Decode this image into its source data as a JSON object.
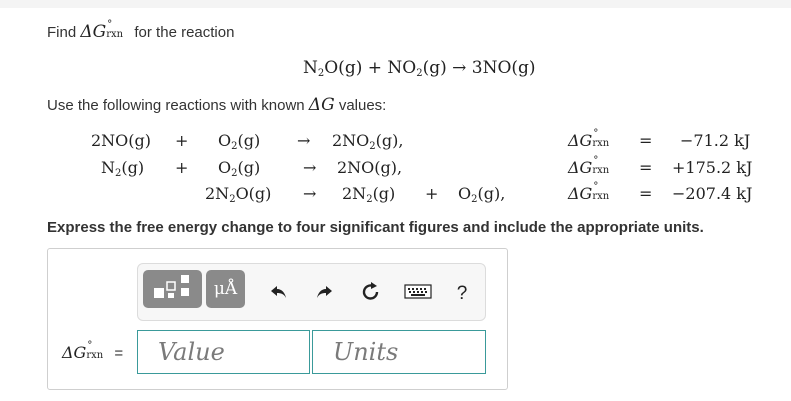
{
  "prompt": {
    "find_prefix": "Find ",
    "delta_g": "ΔG",
    "degree": "°",
    "rxn": "rxn",
    "find_suffix": " for the reaction"
  },
  "target_reaction": {
    "lhs1": "N",
    "lhs1_sub": "2",
    "lhs1_rest": "O(g) + NO",
    "lhs2_sub": "2",
    "lhs2_rest": "(g) → 3NO(g)"
  },
  "use_text": {
    "prefix": "Use the following reactions with known ",
    "delta_g": "ΔG",
    "suffix": " values:"
  },
  "reactions": [
    {
      "r1": "2NO(g)",
      "plus1": "+",
      "r2": "O",
      "r2_sub": "2",
      "r2_rest": "(g)",
      "arrow": "→",
      "p1": "2NO",
      "p1_sub": "2",
      "p1_rest": "(g),",
      "plus2": "",
      "p2": "",
      "dg": "ΔG",
      "eq": "=",
      "value": "−71.2 kJ"
    },
    {
      "r1": "N",
      "r1_sub": "2",
      "r1_rest": "(g)",
      "plus1": "+",
      "r2": "O",
      "r2_sub": "2",
      "r2_rest": "(g)",
      "arrow": "→",
      "p1": "2NO(g),",
      "dg": "ΔG",
      "eq": "=",
      "value": "+175.2 kJ"
    },
    {
      "r1": "2N",
      "r1_sub": "2",
      "r1_rest": "O(g)",
      "arrow": "→",
      "p1": "2N",
      "p1_sub": "2",
      "p1_rest": "(g)",
      "plus2": "+",
      "p2": "O",
      "p2_sub": "2",
      "p2_rest": "(g),",
      "dg": "ΔG",
      "eq": "=",
      "value": "−207.4 kJ"
    }
  ],
  "instruction": "Express the free energy change to four significant figures and include the appropriate units.",
  "toolbar": {
    "template_icon": "template-icon",
    "units_label": "μÅ",
    "undo_icon": "undo-icon",
    "redo_icon": "redo-icon",
    "reset_icon": "reset-icon",
    "keyboard_icon": "keyboard-icon",
    "help_label": "?"
  },
  "answer": {
    "label_dg": "ΔG",
    "label_eq": "=",
    "value_placeholder": "Value",
    "units_placeholder": "Units"
  }
}
